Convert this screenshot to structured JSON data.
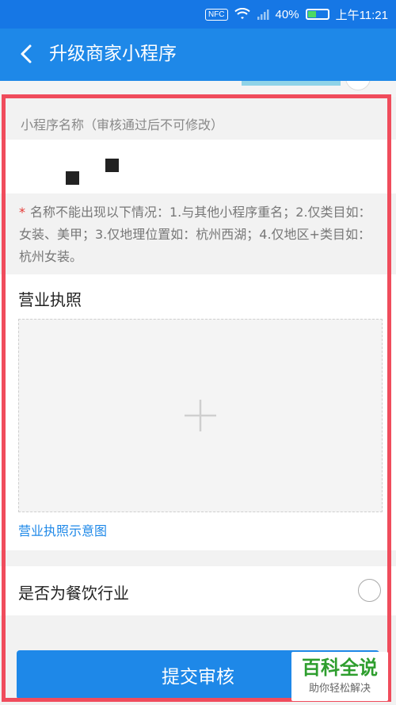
{
  "status_bar": {
    "nfc": "NFC",
    "battery": "40%",
    "time": "上午11:21"
  },
  "nav": {
    "title": "升级商家小程序"
  },
  "form": {
    "name_label": "小程序名称（审核通过后不可修改）",
    "notice_star": "*",
    "notice": "名称不能出现以下情况：1.与其他小程序重名；2.仅类目如：女装、美甲；3.仅地理位置如：杭州西湖；4.仅地区+类目如：杭州女装。",
    "license_title": "营业执照",
    "license_sample_link": "营业执照示意图",
    "food_industry_label": "是否为餐饮行业"
  },
  "submit_label": "提交审核",
  "watermark": {
    "title": "百科全说",
    "subtitle": "助你轻松解决"
  },
  "colors": {
    "primary": "#1e88e8",
    "status_bar": "#1677e5",
    "highlight": "#f04c5c",
    "watermark_green": "#2e9e2e"
  }
}
